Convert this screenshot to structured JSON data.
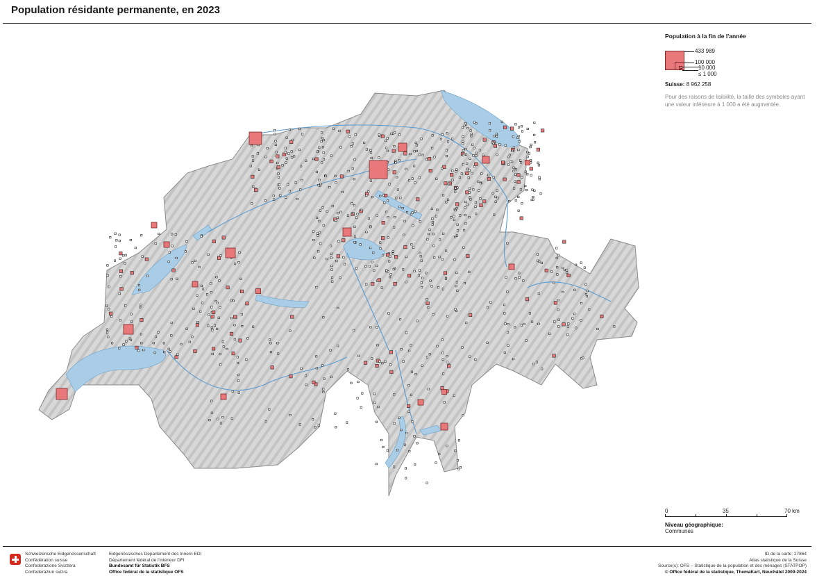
{
  "header": {
    "title": "Population résidante permanente, en 2023"
  },
  "legend": {
    "heading": "Population à la fin de l'année",
    "classes": [
      "433 989",
      "100 000",
      "10 000",
      "≤ 1 000"
    ],
    "total_label": "Suisse:",
    "total_value": "8 962 258",
    "note": "Pour des raisons de lisibilité, la taille des symboles ayant une valeur inférieure à 1 000 a été augmentée.",
    "symbol_color": "#e8787a"
  },
  "scalebar": {
    "ticks": [
      "0",
      "35",
      "70 km"
    ]
  },
  "geo_level": {
    "label": "Niveau géographique:",
    "value": "Communes"
  },
  "footer": {
    "confederation": [
      "Schweizerische Eidgenossenschaft",
      "Confédération suisse",
      "Confederazione Svizzera",
      "Confederaziun svizra"
    ],
    "department": [
      "Eidgenössisches Departement des Innern EDI",
      "Département fédéral de l'intérieur DFI"
    ],
    "office": [
      "Bundesamt für Statistik BFS",
      "Office fédéral de la statistique OFS"
    ],
    "map_id": "ID de la carte: 27864",
    "atlas": "Atlas statistique de la Suisse",
    "source": "Source(s): OFS – Statistique de la population et des ménages (STATPOP)",
    "copyright": "© Office fédéral de la statistique, ThemaKart, Neuchâtel 2009-2024"
  },
  "colors": {
    "land": "#dcdcdc",
    "lake": "#a9cde6",
    "river": "#5b9bd0",
    "symbol": "#e8787a",
    "symbol_border": "#7a2a2a"
  }
}
